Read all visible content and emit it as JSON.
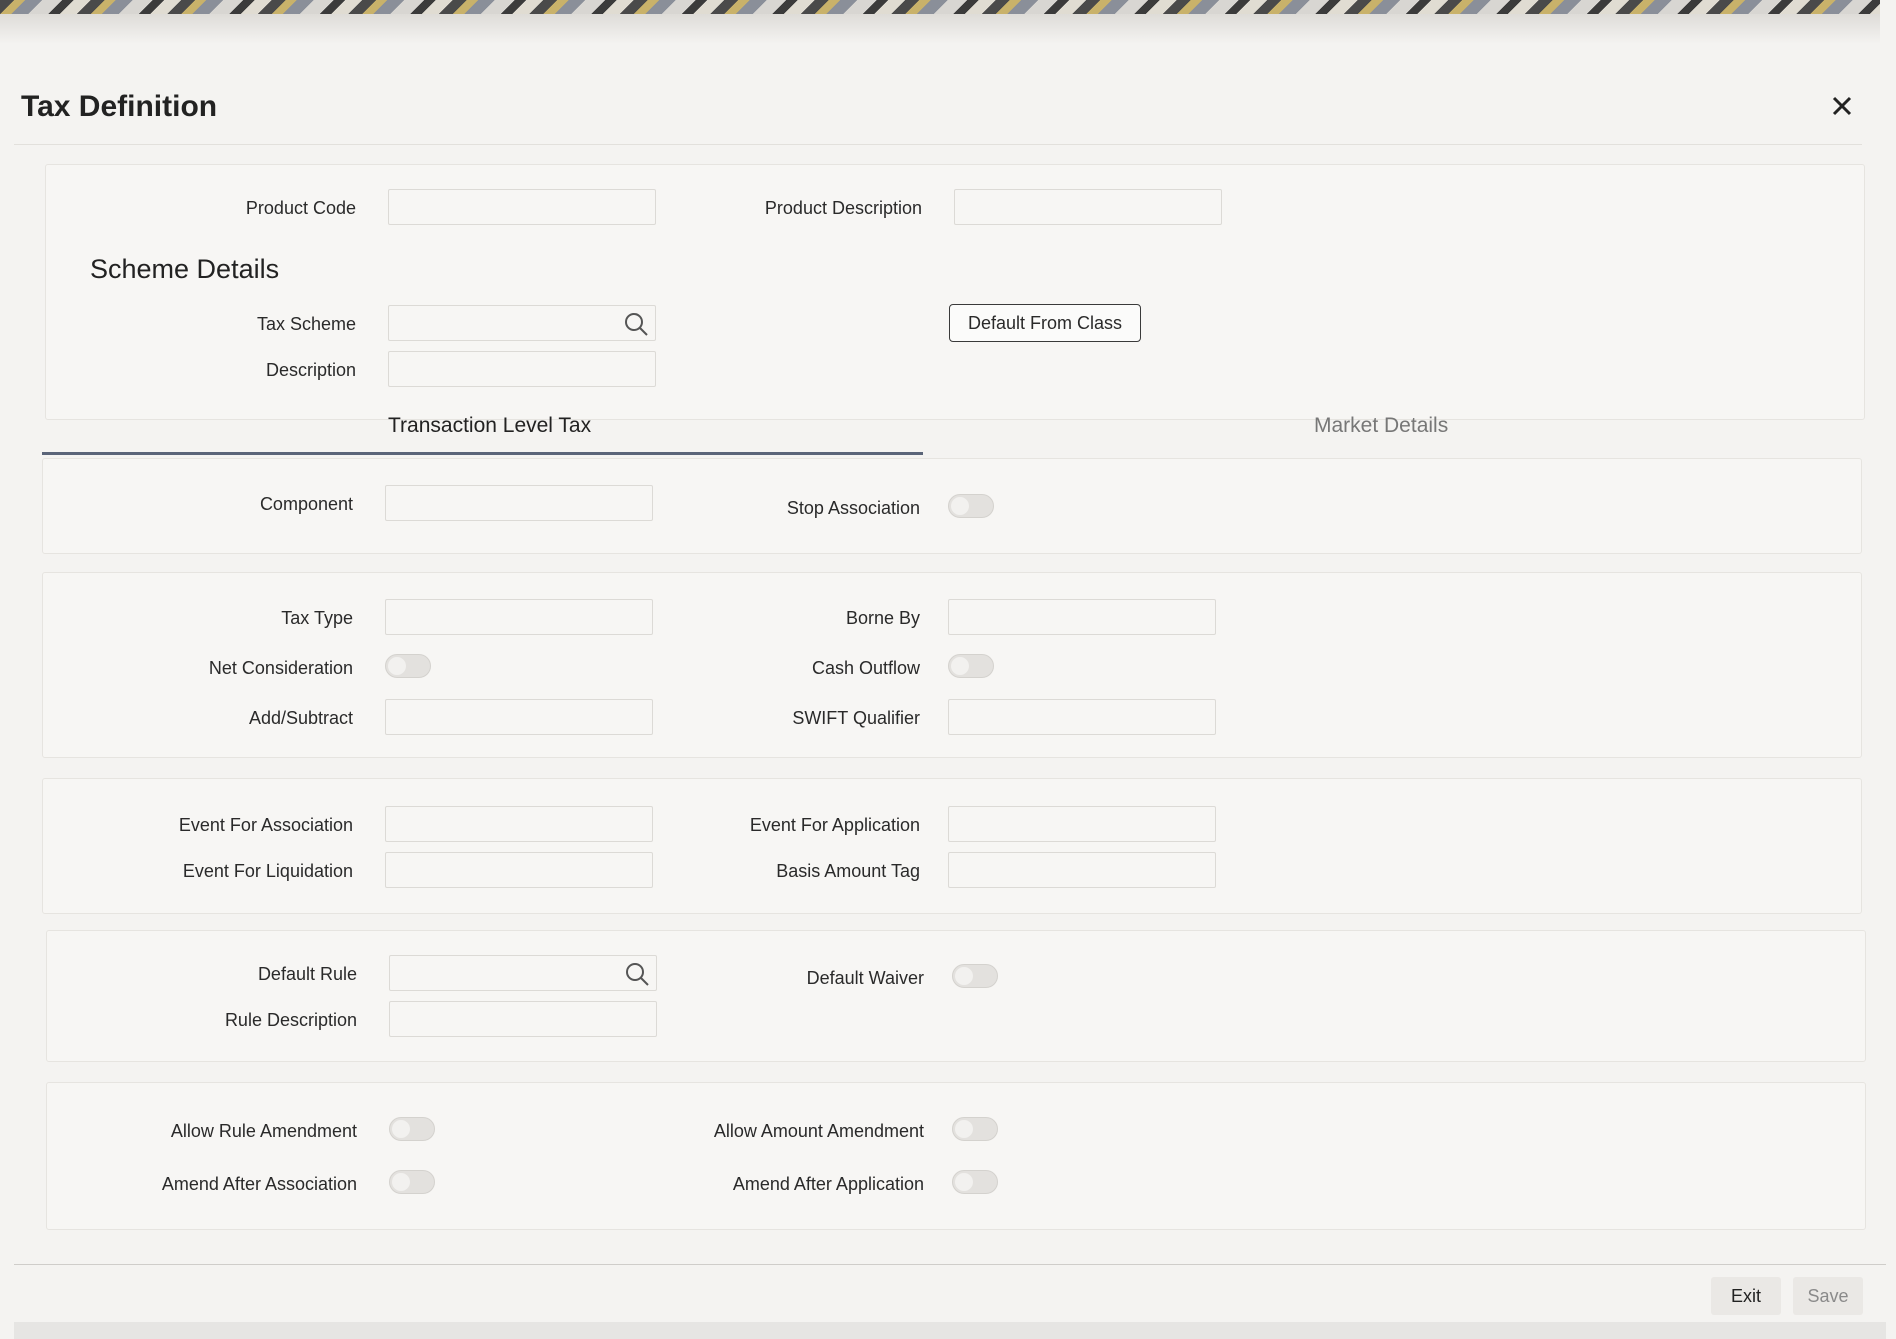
{
  "window": {
    "title": "Tax Definition"
  },
  "header": {
    "product_code_label": "Product Code",
    "product_description_label": "Product Description"
  },
  "scheme": {
    "heading": "Scheme Details",
    "tax_scheme_label": "Tax Scheme",
    "description_label": "Description",
    "default_from_class_label": "Default From Class"
  },
  "tabs": [
    {
      "label": "Transaction Level Tax",
      "active": true
    },
    {
      "label": "Market Details",
      "active": false
    }
  ],
  "component_section": {
    "component_label": "Component",
    "stop_association_label": "Stop Association"
  },
  "tax_section": {
    "tax_type_label": "Tax Type",
    "borne_by_label": "Borne By",
    "net_consideration_label": "Net Consideration",
    "cash_outflow_label": "Cash Outflow",
    "add_subtract_label": "Add/Subtract",
    "swift_qualifier_label": "SWIFT Qualifier"
  },
  "event_section": {
    "event_association_label": "Event For Association",
    "event_application_label": "Event For Application",
    "event_liquidation_label": "Event For Liquidation",
    "basis_amount_tag_label": "Basis Amount Tag"
  },
  "rule_section": {
    "default_rule_label": "Default Rule",
    "default_waiver_label": "Default Waiver",
    "rule_description_label": "Rule Description"
  },
  "amend_section": {
    "allow_rule_amendment_label": "Allow Rule Amendment",
    "allow_amount_amendment_label": "Allow Amount Amendment",
    "amend_after_association_label": "Amend After Association",
    "amend_after_application_label": "Amend After Application"
  },
  "footer": {
    "exit_label": "Exit",
    "save_label": "Save"
  },
  "colors": {
    "tab_active_underline": "#5a6478",
    "disabled_text": "#8a8a8a"
  }
}
